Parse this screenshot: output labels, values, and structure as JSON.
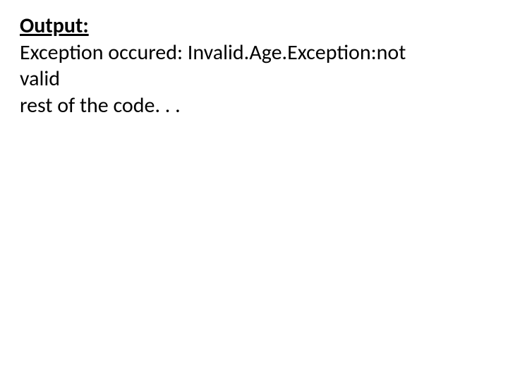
{
  "slide": {
    "heading": "Output:",
    "line1": "Exception occured: Invalid.Age.Exception:not",
    "line2": "valid",
    "line3": "rest of the code. . ."
  }
}
